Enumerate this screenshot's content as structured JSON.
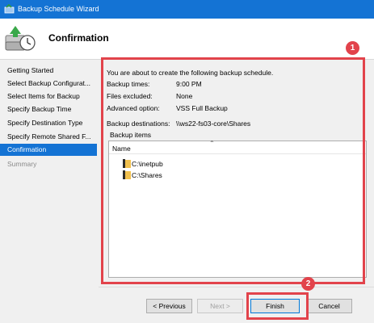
{
  "window": {
    "title": "Backup Schedule Wizard"
  },
  "header": {
    "title": "Confirmation"
  },
  "nav": {
    "items": [
      {
        "label": "Getting Started",
        "state": "normal"
      },
      {
        "label": "Select Backup Configurat...",
        "state": "normal"
      },
      {
        "label": "Select Items for Backup",
        "state": "normal"
      },
      {
        "label": "Specify Backup Time",
        "state": "normal"
      },
      {
        "label": "Specify Destination Type",
        "state": "normal"
      },
      {
        "label": "Specify Remote Shared F...",
        "state": "normal"
      },
      {
        "label": "Confirmation",
        "state": "active"
      },
      {
        "label": "Summary",
        "state": "disabled"
      }
    ]
  },
  "content": {
    "intro": "You are about to create the following backup schedule.",
    "details": {
      "backup_times_label": "Backup times:",
      "backup_times_value": "9:00 PM",
      "files_excluded_label": "Files excluded:",
      "files_excluded_value": "None",
      "advanced_option_label": "Advanced option:",
      "advanced_option_value": "VSS Full Backup",
      "backup_destinations_label": "Backup destinations:",
      "backup_destinations_value": "\\\\ws22-fs03-core\\Shares"
    },
    "backup_items": {
      "label": "Backup items",
      "column_header": "Name",
      "items": [
        "C:\\inetpub",
        "C:\\Shares"
      ]
    }
  },
  "annotations": {
    "badge1": "1",
    "badge2": "2",
    "highlight_color": "#e2434b"
  },
  "buttons": {
    "previous": "< Previous",
    "next": "Next >",
    "finish": "Finish",
    "cancel": "Cancel"
  },
  "colors": {
    "accent": "#1473d4",
    "highlight": "#e2434b"
  }
}
